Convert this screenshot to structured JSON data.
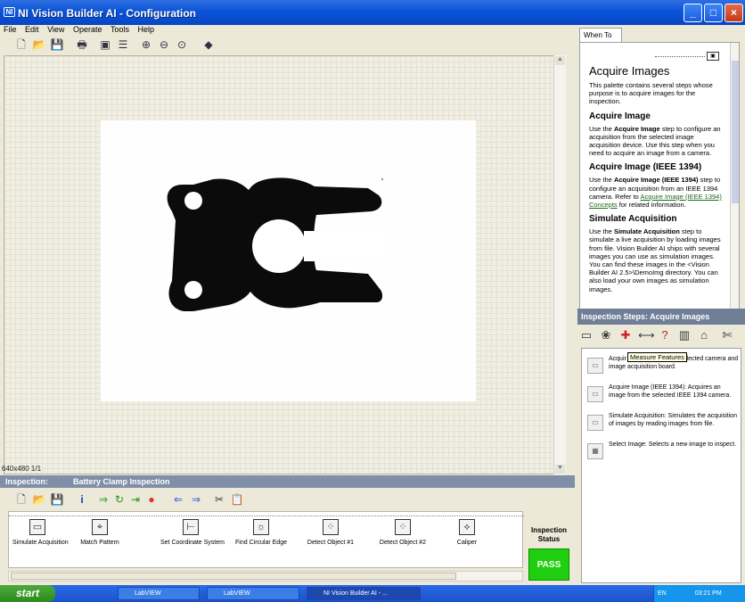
{
  "window": {
    "title": "NI Vision Builder AI - Configuration",
    "controls": [
      "minimize",
      "maximize",
      "close"
    ]
  },
  "menu": [
    "File",
    "Edit",
    "View",
    "Operate",
    "Tools",
    "Help"
  ],
  "toolbar_icons": [
    "new-icon",
    "open-icon",
    "save-icon",
    "print-icon",
    "acquire-icon",
    "properties-icon",
    "zoom-in-icon",
    "zoom-out-icon",
    "zoom-fit-icon",
    "tag-icon"
  ],
  "image_view": {
    "resolution_label": "640x480 1/1"
  },
  "inspection": {
    "label": "Inspection:",
    "name": "Battery Clamp Inspection",
    "toolbar_icons": [
      "new-icon",
      "open-icon",
      "save-icon",
      "info-icon",
      "run-1-icon",
      "run-loop-icon",
      "run-to-icon",
      "stop-icon",
      "back-icon",
      "forward-icon",
      "cut-icon",
      "paste-icon"
    ],
    "steps": [
      {
        "label": "Simulate Acquisition",
        "icon": "simulate-acquisition-icon"
      },
      {
        "label": "Match Pattern",
        "icon": "match-pattern-icon"
      },
      {
        "label": "Set Coordinate System",
        "icon": "coordinate-system-icon"
      },
      {
        "label": "Find Circular Edge",
        "icon": "circular-edge-icon"
      },
      {
        "label": "Detect Object #1",
        "icon": "detect-object-icon"
      },
      {
        "label": "Detect Object #2",
        "icon": "detect-object-icon"
      },
      {
        "label": "Caliper",
        "icon": "caliper-icon"
      }
    ],
    "status_label": "Inspection Status",
    "status_value": "PASS",
    "status_color": "#20d010"
  },
  "right_panel": {
    "tab": "When To",
    "help": {
      "title": "Acquire Images",
      "intro": "This palette contains several steps whose purpose is to acquire images for the inspection.",
      "sections": [
        {
          "heading": "Acquire Image",
          "pre": "Use the ",
          "bold": "Acquire Image",
          "post": " step to configure an acquisition from the selected image acquisition device. Use this step when you need to acquire an image from a camera."
        },
        {
          "heading": "Acquire Image (IEEE 1394)",
          "pre": "Use the ",
          "bold": "Acquire Image (IEEE 1394)",
          "post": " step to configure an acquisition from an IEEE 1394 camera. Refer to ",
          "link": "Acquire Image (IEEE 1394) Concepts",
          "post2": " for related information."
        },
        {
          "heading": "Simulate Acquisition",
          "pre": "Use the ",
          "bold": "Simulate Acquisition",
          "post": " step to simulate a live acquisition by loading images from file. Vision Builder AI ships with several images you can use as simulation images. You can find these images in the <Vision Builder AI 2.5>\\DemoImg directory. You can also load your own images as simulation images."
        }
      ]
    },
    "steps_header": "Inspection Steps: Acquire Images",
    "step_icons": [
      "acquire-images-icon",
      "enhance-images-icon",
      "locate-features-icon",
      "measure-features-icon",
      "check-for-presence-icon",
      "identify-parts-icon",
      "use-additional-tools-icon",
      "communicate-icon"
    ],
    "tooltip": "Measure Features",
    "steps_list": [
      {
        "icon": "camera-icon",
        "text_before": "Acquir",
        "text_after": " an image from the selected camera and image acquisition board."
      },
      {
        "icon": "ieee-1394-camera-icon",
        "text": "Acquire Image (IEEE 1394): Acquires an image from the selected IEEE 1394 camera."
      },
      {
        "icon": "simulate-acquisition-icon",
        "text": "Simulate Acquisition: Simulates the acquisition of images by reading images from file."
      },
      {
        "icon": "select-image-icon",
        "text": "Select Image: Selects a new image to inspect."
      }
    ]
  },
  "taskbar": {
    "start": "start",
    "tasks": [
      "LabVIEW",
      "LabVIEW",
      "NI Vision Builder AI - ..."
    ],
    "tray": {
      "lang": "EN",
      "time": "03:21 PM"
    }
  }
}
